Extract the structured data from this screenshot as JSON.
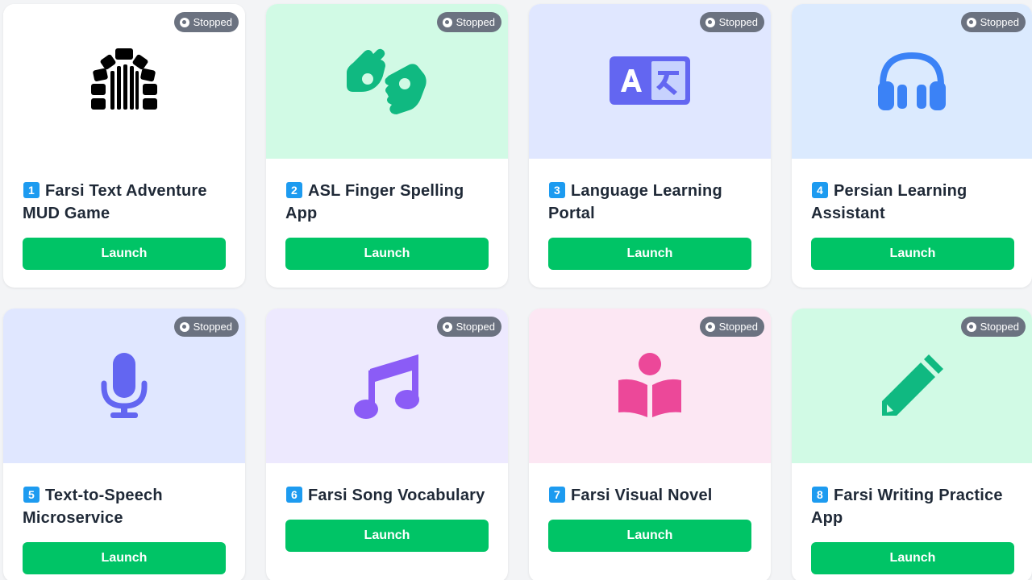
{
  "cards": [
    {
      "num": "1",
      "title": "Farsi Text Adventure MUD Game",
      "status": "Stopped",
      "launch": "Launch",
      "hero_bg": "#ffffff",
      "icon": "dungeon-gate-icon",
      "icon_color": "#000000"
    },
    {
      "num": "2",
      "title": "ASL Finger Spelling App",
      "status": "Stopped",
      "launch": "Launch",
      "hero_bg": "#d1fae5",
      "icon": "sign-language-icon",
      "icon_color": "#10b981"
    },
    {
      "num": "3",
      "title": "Language Learning Portal",
      "status": "Stopped",
      "launch": "Launch",
      "hero_bg": "#e0e7ff",
      "icon": "translate-icon",
      "icon_color": "#6366f1"
    },
    {
      "num": "4",
      "title": "Persian Learning Assistant",
      "status": "Stopped",
      "launch": "Launch",
      "hero_bg": "#dbeafe",
      "icon": "headphones-icon",
      "icon_color": "#3b82f6"
    },
    {
      "num": "5",
      "title": "Text-to-Speech Microservice",
      "status": "Stopped",
      "launch": "Launch",
      "hero_bg": "#e0e7ff",
      "icon": "microphone-icon",
      "icon_color": "#6366f1"
    },
    {
      "num": "6",
      "title": "Farsi Song Vocabulary",
      "status": "Stopped",
      "launch": "Launch",
      "hero_bg": "#ede9fe",
      "icon": "music-note-icon",
      "icon_color": "#8b5cf6"
    },
    {
      "num": "7",
      "title": "Farsi Visual Novel",
      "status": "Stopped",
      "launch": "Launch",
      "hero_bg": "#fce7f3",
      "icon": "reader-book-icon",
      "icon_color": "#ec4899"
    },
    {
      "num": "8",
      "title": "Farsi Writing Practice App",
      "status": "Stopped",
      "launch": "Launch",
      "hero_bg": "#d1fae5",
      "icon": "pencil-icon",
      "icon_color": "#10b981"
    }
  ]
}
